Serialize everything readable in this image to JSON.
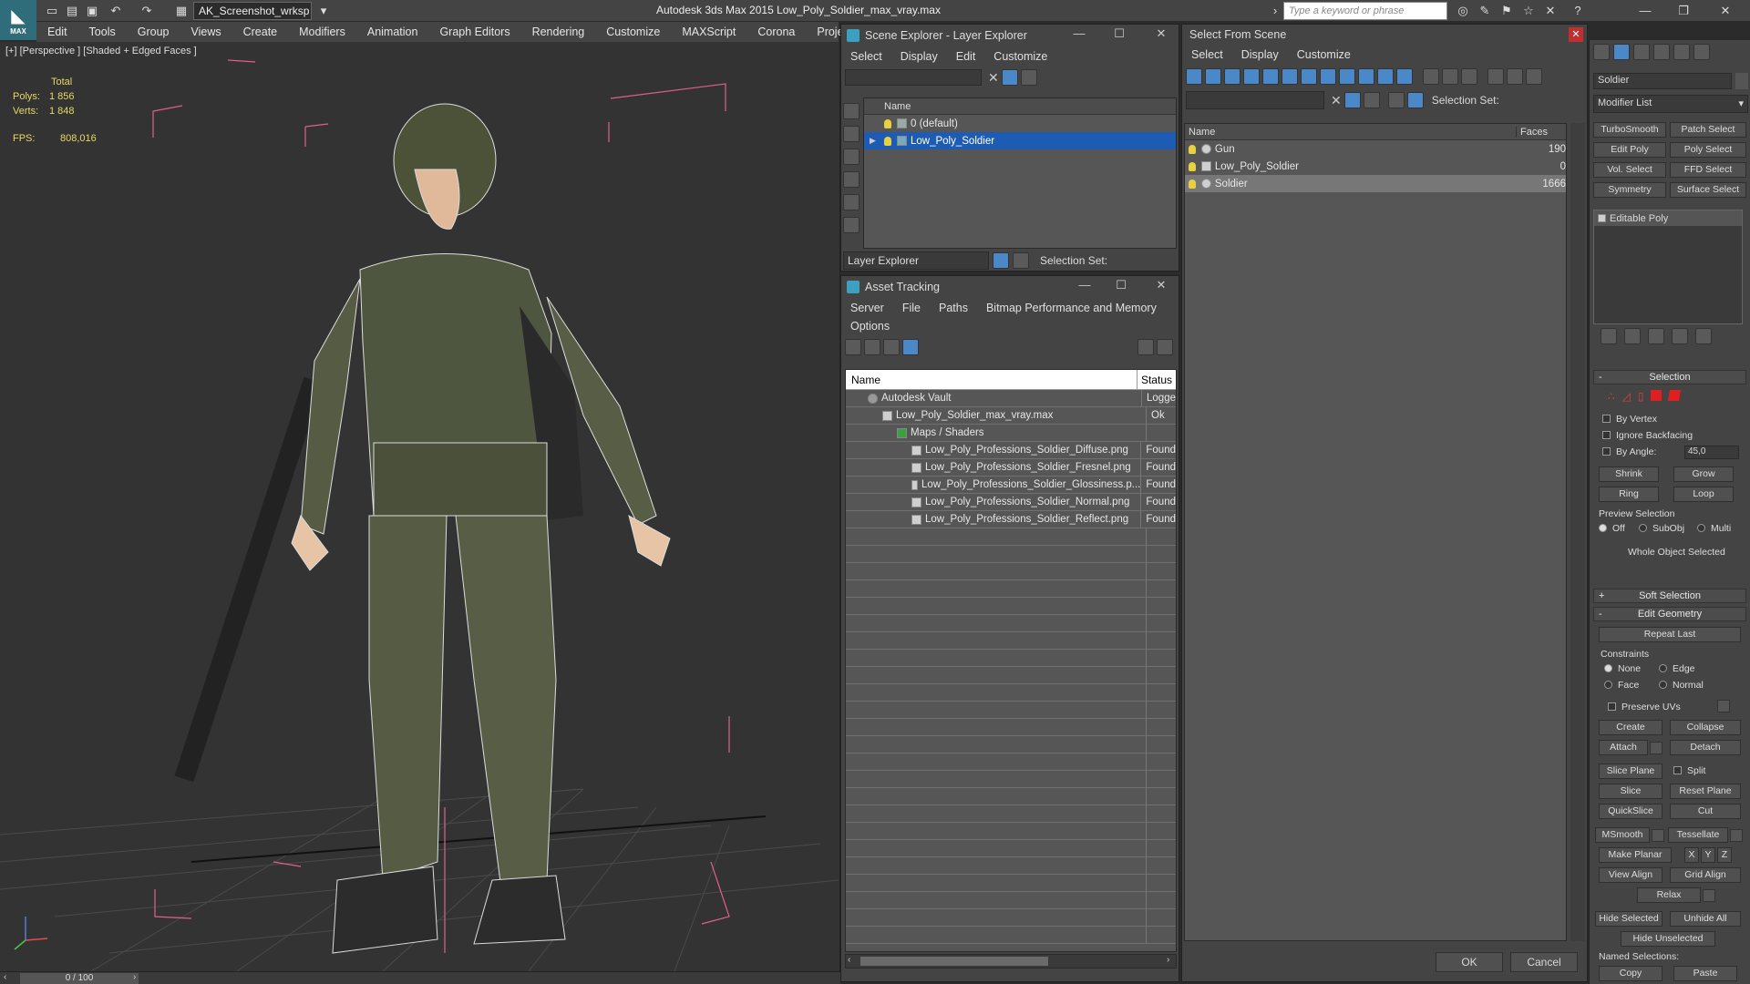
{
  "app": {
    "logo_text": "MAX",
    "workspace": "AK_Screenshot_wrksp",
    "title": "Autodesk 3ds Max  2015     Low_Poly_Soldier_max_vray.max",
    "search_placeholder": "Type a keyword or phrase"
  },
  "menubar": [
    "Edit",
    "Tools",
    "Group",
    "Views",
    "Create",
    "Modifiers",
    "Animation",
    "Graph Editors",
    "Rendering",
    "Customize",
    "MAXScript",
    "Corona",
    "Project Man"
  ],
  "viewport": {
    "label": "[+] [Perspective ] [Shaded + Edged Faces ]",
    "stats": {
      "header": "Total",
      "polys_label": "Polys:",
      "polys": "1 856",
      "verts_label": "Verts:",
      "verts": "1 848",
      "fps_label": "FPS:",
      "fps": "808,016"
    },
    "timeline": "0 / 100"
  },
  "scene_explorer": {
    "title": "Scene Explorer - Layer Explorer",
    "menu": [
      "Select",
      "Display",
      "Edit",
      "Customize"
    ],
    "col_name": "Name",
    "rows": [
      {
        "label": "0 (default)"
      },
      {
        "label": "Low_Poly_Soldier"
      }
    ],
    "footer_combo": "Layer Explorer",
    "selection_set": "Selection Set:"
  },
  "asset_tracking": {
    "title": "Asset Tracking",
    "menu": [
      "Server",
      "File",
      "Paths",
      "Bitmap Performance and Memory"
    ],
    "menu2": "Options",
    "col_name": "Name",
    "col_status": "Status",
    "rows": [
      {
        "name": "Autodesk Vault",
        "status": "Logge",
        "indent": 1
      },
      {
        "name": "Low_Poly_Soldier_max_vray.max",
        "status": "Ok",
        "indent": 2
      },
      {
        "name": "Maps / Shaders",
        "status": "",
        "indent": 3
      },
      {
        "name": "Low_Poly_Professions_Soldier_Diffuse.png",
        "status": "Found",
        "indent": 4
      },
      {
        "name": "Low_Poly_Professions_Soldier_Fresnel.png",
        "status": "Found",
        "indent": 4
      },
      {
        "name": "Low_Poly_Professions_Soldier_Glossiness.p...",
        "status": "Found",
        "indent": 4
      },
      {
        "name": "Low_Poly_Professions_Soldier_Normal.png",
        "status": "Found",
        "indent": 4
      },
      {
        "name": "Low_Poly_Professions_Soldier_Reflect.png",
        "status": "Found",
        "indent": 4
      }
    ]
  },
  "select_from_scene": {
    "title": "Select From Scene",
    "menu": [
      "Select",
      "Display",
      "Customize"
    ],
    "selection_set": "Selection Set:",
    "col_name": "Name",
    "col_faces": "Faces",
    "rows": [
      {
        "name": "Gun",
        "faces": "190"
      },
      {
        "name": "Low_Poly_Soldier",
        "faces": "0"
      },
      {
        "name": "Soldier",
        "faces": "1666"
      }
    ],
    "ok": "OK",
    "cancel": "Cancel"
  },
  "command_panel": {
    "object_name": "Soldier",
    "modifier_list": "Modifier List",
    "modifier_buttons": [
      "TurboSmooth",
      "Patch Select",
      "Edit Poly",
      "Poly Select",
      "Vol. Select",
      "FFD Select",
      "Symmetry",
      "Surface Select"
    ],
    "stack_item": "Editable Poly",
    "selection_rollout": "Selection",
    "by_vertex": "By Vertex",
    "ignore_backfacing": "Ignore Backfacing",
    "by_angle": "By Angle:",
    "angle_value": "45,0",
    "shrink": "Shrink",
    "grow": "Grow",
    "ring": "Ring",
    "loop": "Loop",
    "preview_selection": "Preview Selection",
    "preview_off": "Off",
    "preview_subobj": "SubObj",
    "preview_multi": "Multi",
    "whole_object": "Whole Object Selected",
    "soft_selection": "Soft Selection",
    "edit_geometry": "Edit Geometry",
    "repeat_last": "Repeat Last",
    "constraints": "Constraints",
    "c_none": "None",
    "c_edge": "Edge",
    "c_face": "Face",
    "c_normal": "Normal",
    "preserve_uvs": "Preserve UVs",
    "create": "Create",
    "collapse": "Collapse",
    "attach": "Attach",
    "detach": "Detach",
    "slice_plane": "Slice Plane",
    "split": "Split",
    "slice": "Slice",
    "reset_plane": "Reset Plane",
    "quickslice": "QuickSlice",
    "cut": "Cut",
    "msmooth": "MSmooth",
    "tessellate": "Tessellate",
    "make_planar": "Make Planar",
    "x": "X",
    "y": "Y",
    "z": "Z",
    "view_align": "View Align",
    "grid_align": "Grid Align",
    "relax": "Relax",
    "hide_selected": "Hide Selected",
    "unhide_all": "Unhide All",
    "hide_unselected": "Hide Unselected",
    "named_selections": "Named Selections:",
    "copy": "Copy",
    "paste": "Paste"
  }
}
